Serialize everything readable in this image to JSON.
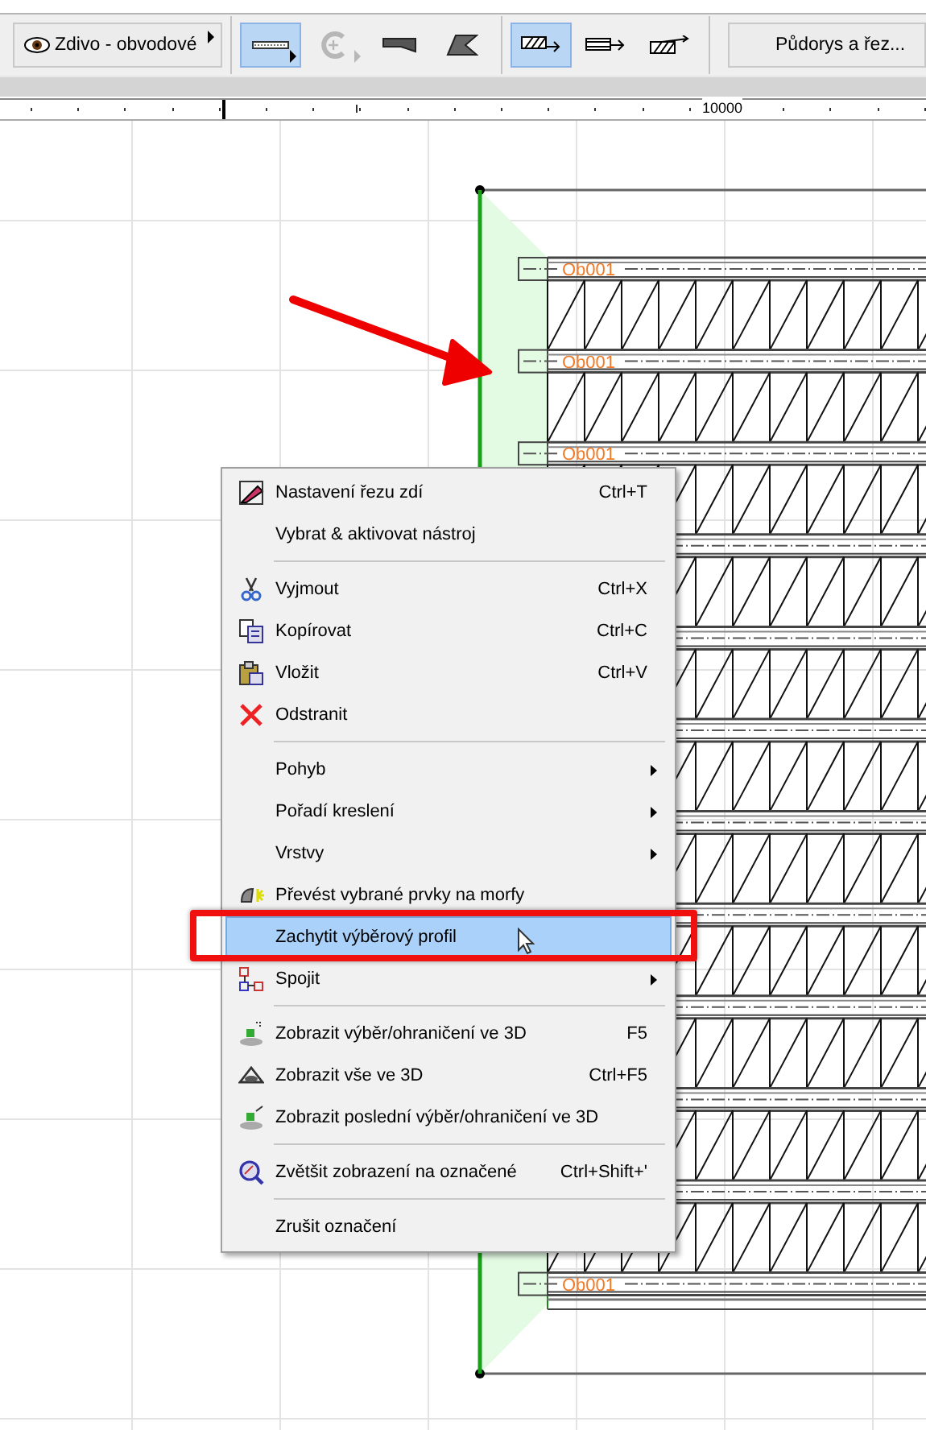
{
  "toolbar": {
    "layer_button": {
      "label": "Zdivo - obvodové"
    },
    "tools": [
      {
        "selected": true,
        "disabled": false
      },
      {
        "selected": false,
        "disabled": true
      },
      {
        "selected": false,
        "disabled": false
      },
      {
        "selected": false,
        "disabled": false
      }
    ],
    "modes": [
      {
        "selected": true
      },
      {
        "selected": false
      },
      {
        "selected": false
      }
    ],
    "view_button": {
      "label": "Půdorys a řez..."
    }
  },
  "ruler": {
    "label": "10000"
  },
  "beam_labels": [
    "Ob001",
    "Ob001",
    "Ob001",
    "Ob001"
  ],
  "context_menu": [
    {
      "kind": "item",
      "label": "Nastavení řezu zdí",
      "shortcut": "Ctrl+T",
      "submenu": false,
      "selected": false
    },
    {
      "kind": "item",
      "label": "Vybrat & aktivovat nástroj",
      "submenu": false,
      "selected": false
    },
    {
      "kind": "separator"
    },
    {
      "kind": "item",
      "label": "Vyjmout",
      "shortcut": "Ctrl+X",
      "submenu": false,
      "selected": false
    },
    {
      "kind": "item",
      "label": "Kopírovat",
      "shortcut": "Ctrl+C",
      "submenu": false,
      "selected": false
    },
    {
      "kind": "item",
      "label": "Vložit",
      "shortcut": "Ctrl+V",
      "submenu": false,
      "selected": false
    },
    {
      "kind": "item",
      "label": "Odstranit",
      "submenu": false,
      "selected": false
    },
    {
      "kind": "separator"
    },
    {
      "kind": "item",
      "label": "Pohyb",
      "submenu": true,
      "selected": false
    },
    {
      "kind": "item",
      "label": "Pořadí kreslení",
      "submenu": true,
      "selected": false
    },
    {
      "kind": "item",
      "label": "Vrstvy",
      "submenu": true,
      "selected": false
    },
    {
      "kind": "item",
      "label": "Převést vybrané prvky na morfy",
      "submenu": false,
      "selected": false
    },
    {
      "kind": "item",
      "label": "Zachytit výběrový profil",
      "submenu": false,
      "selected": true
    },
    {
      "kind": "item",
      "label": "Spojit",
      "submenu": true,
      "selected": false
    },
    {
      "kind": "separator"
    },
    {
      "kind": "item",
      "label": "Zobrazit výběr/ohraničení ve 3D",
      "shortcut": "F5",
      "submenu": false,
      "selected": false
    },
    {
      "kind": "item",
      "label": "Zobrazit vše ve 3D",
      "shortcut": "Ctrl+F5",
      "submenu": false,
      "selected": false
    },
    {
      "kind": "item",
      "label": "Zobrazit poslední výběr/ohraničení ve 3D",
      "submenu": false,
      "selected": false
    },
    {
      "kind": "separator"
    },
    {
      "kind": "item",
      "label": "Zvětšit zobrazení na označené",
      "shortcut": "Ctrl+Shift+'",
      "submenu": false,
      "selected": false
    },
    {
      "kind": "separator"
    },
    {
      "kind": "item",
      "label": "Zrušit označení",
      "submenu": false,
      "selected": false
    }
  ]
}
